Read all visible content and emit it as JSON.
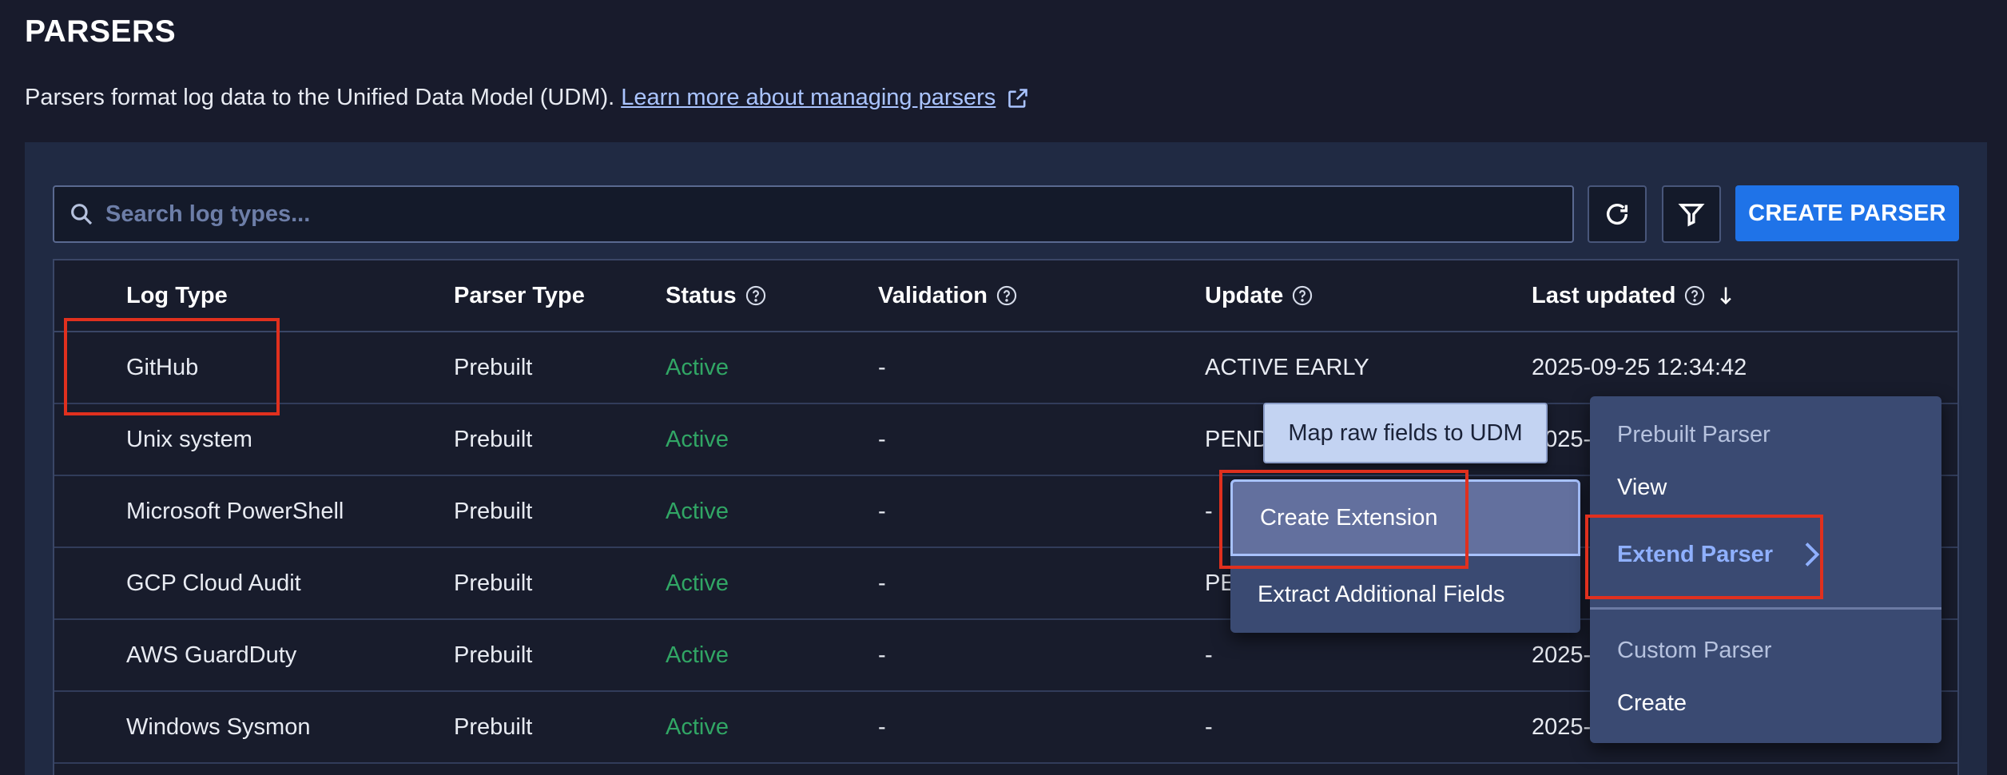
{
  "page": {
    "title": "PARSERS",
    "description": "Parsers format log data to the Unified Data Model (UDM).",
    "learn_more_link": "Learn more about managing parsers",
    "external_link_icon": "external-link-icon"
  },
  "toolbar": {
    "search_placeholder": "Search log types...",
    "search_value": "",
    "search_icon": "search-icon",
    "refresh_icon": "refresh-icon",
    "filter_icon": "filter-icon",
    "create_button": "CREATE PARSER"
  },
  "table": {
    "headers": {
      "log_type": "Log Type",
      "parser_type": "Parser Type",
      "status": "Status",
      "validation": "Validation",
      "update": "Update",
      "last_updated": "Last updated"
    },
    "rows": [
      {
        "log_type": "GitHub",
        "parser_type": "Prebuilt",
        "status": "Active",
        "validation": "-",
        "update": "ACTIVE EARLY",
        "last_updated": "2025-09-25 12:34:42"
      },
      {
        "log_type": "Unix system",
        "parser_type": "Prebuilt",
        "status": "Active",
        "validation": "-",
        "update": "PEND",
        "last_updated": "2025-0"
      },
      {
        "log_type": "Microsoft PowerShell",
        "parser_type": "Prebuilt",
        "status": "Active",
        "validation": "-",
        "update": "-",
        "last_updated": ""
      },
      {
        "log_type": "GCP Cloud Audit",
        "parser_type": "Prebuilt",
        "status": "Active",
        "validation": "-",
        "update": "PE",
        "last_updated": ""
      },
      {
        "log_type": "AWS GuardDuty",
        "parser_type": "Prebuilt",
        "status": "Active",
        "validation": "-",
        "update": "-",
        "last_updated": "2025-0"
      },
      {
        "log_type": "Windows Sysmon",
        "parser_type": "Prebuilt",
        "status": "Active",
        "validation": "-",
        "update": "-",
        "last_updated": "2025-0"
      }
    ]
  },
  "tooltip": {
    "text": "Map raw fields to UDM"
  },
  "submenu": {
    "items": [
      "Create Extension",
      "Extract Additional Fields"
    ],
    "selected": "Create Extension"
  },
  "context_menu": {
    "prebuilt_section": "Prebuilt Parser",
    "view": "View",
    "extend_parser": "Extend Parser",
    "custom_section": "Custom Parser",
    "create": "Create"
  },
  "colors": {
    "background": "#181b2c",
    "panel": "#202a43",
    "accent": "#1f73e8",
    "status_active": "#31a665",
    "highlight": "#e0301e",
    "link": "#aac4ff"
  }
}
